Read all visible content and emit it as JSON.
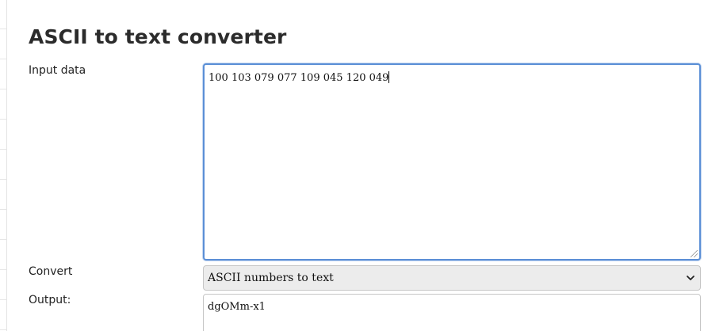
{
  "page": {
    "title": "ASCII to text converter"
  },
  "form": {
    "input_label": "Input data",
    "input_value": "100 103 079 077 109 045 120 049",
    "convert_label": "Convert",
    "convert_selected": "ASCII numbers to text",
    "output_label": "Output:",
    "output_value": "dgOMm-x1"
  },
  "colors": {
    "focus_border": "#5b8fd6",
    "select_bg": "#ececec",
    "field_border": "#c6c6c6"
  },
  "icons": {
    "select_arrow": "chevron-down-icon",
    "resize": "resize-grip-icon"
  }
}
